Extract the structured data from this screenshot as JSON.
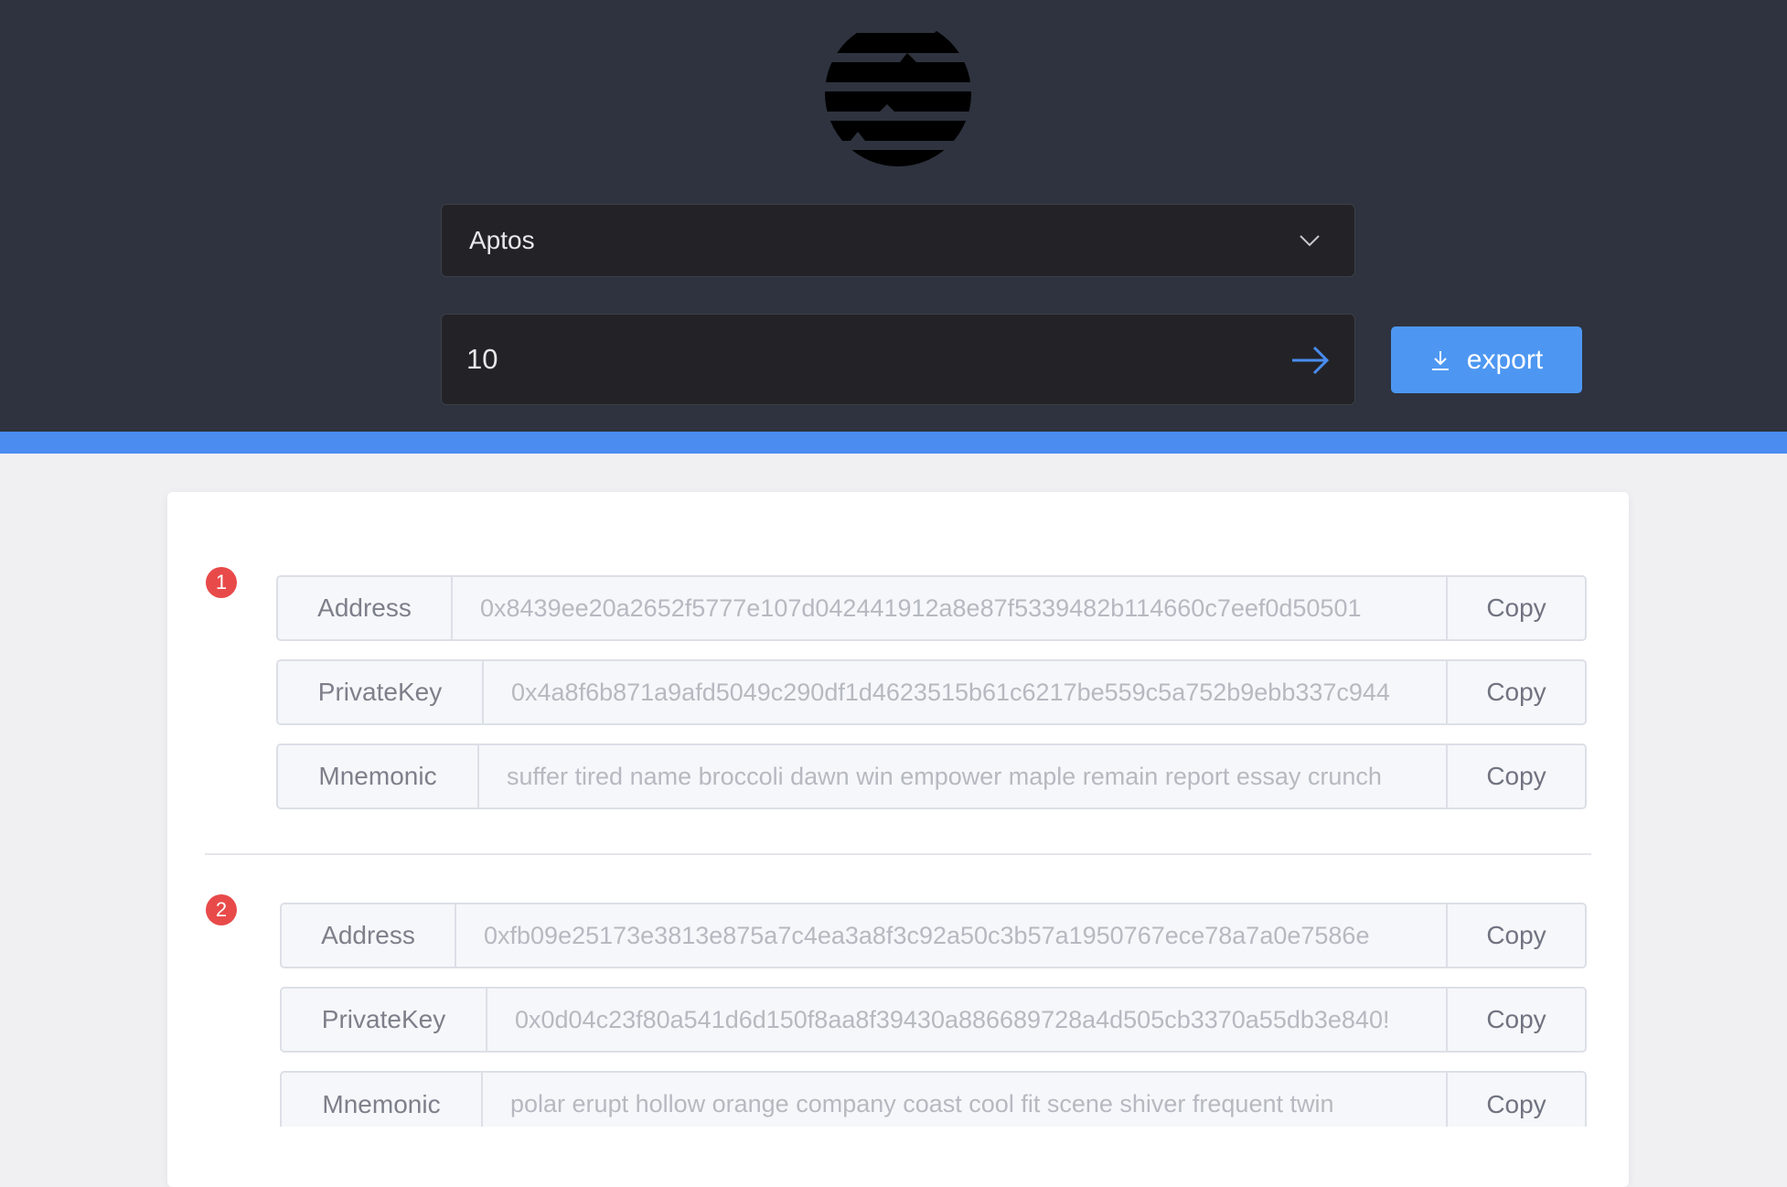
{
  "header": {
    "chain_select": {
      "selected": "Aptos"
    },
    "count_input": {
      "value": "10"
    },
    "export_button": {
      "label": "export"
    }
  },
  "wallets": [
    {
      "index": "1",
      "address": {
        "label": "Address",
        "value": "0x8439ee20a2652f5777e107d042441912a8e87f5339482b114660c7eef0d50501",
        "copy": "Copy"
      },
      "private_key": {
        "label": "PrivateKey",
        "value": "0x4a8f6b871a9afd5049c290df1d4623515b61c6217be559c5a752b9ebb337c944",
        "copy": "Copy"
      },
      "mnemonic": {
        "label": "Mnemonic",
        "value": "suffer tired name broccoli dawn win empower maple remain report essay crunch",
        "copy": "Copy"
      }
    },
    {
      "index": "2",
      "address": {
        "label": "Address",
        "value": "0xfb09e25173e3813e875a7c4ea3a8f3c92a50c3b57a1950767ece78a7a0e7586e",
        "copy": "Copy"
      },
      "private_key": {
        "label": "PrivateKey",
        "value": "0x0d04c23f80a541d6d150f8aa8f39430a886689728a4d505cb3370a55db3e840!",
        "copy": "Copy"
      },
      "mnemonic": {
        "label": "Mnemonic",
        "value": "polar erupt hollow orange company coast cool fit scene shiver frequent twin",
        "copy": "Copy"
      }
    }
  ],
  "colors": {
    "header_bg": "#2e333f",
    "accent": "#4a8cf0",
    "badge": "#e84a4a"
  }
}
